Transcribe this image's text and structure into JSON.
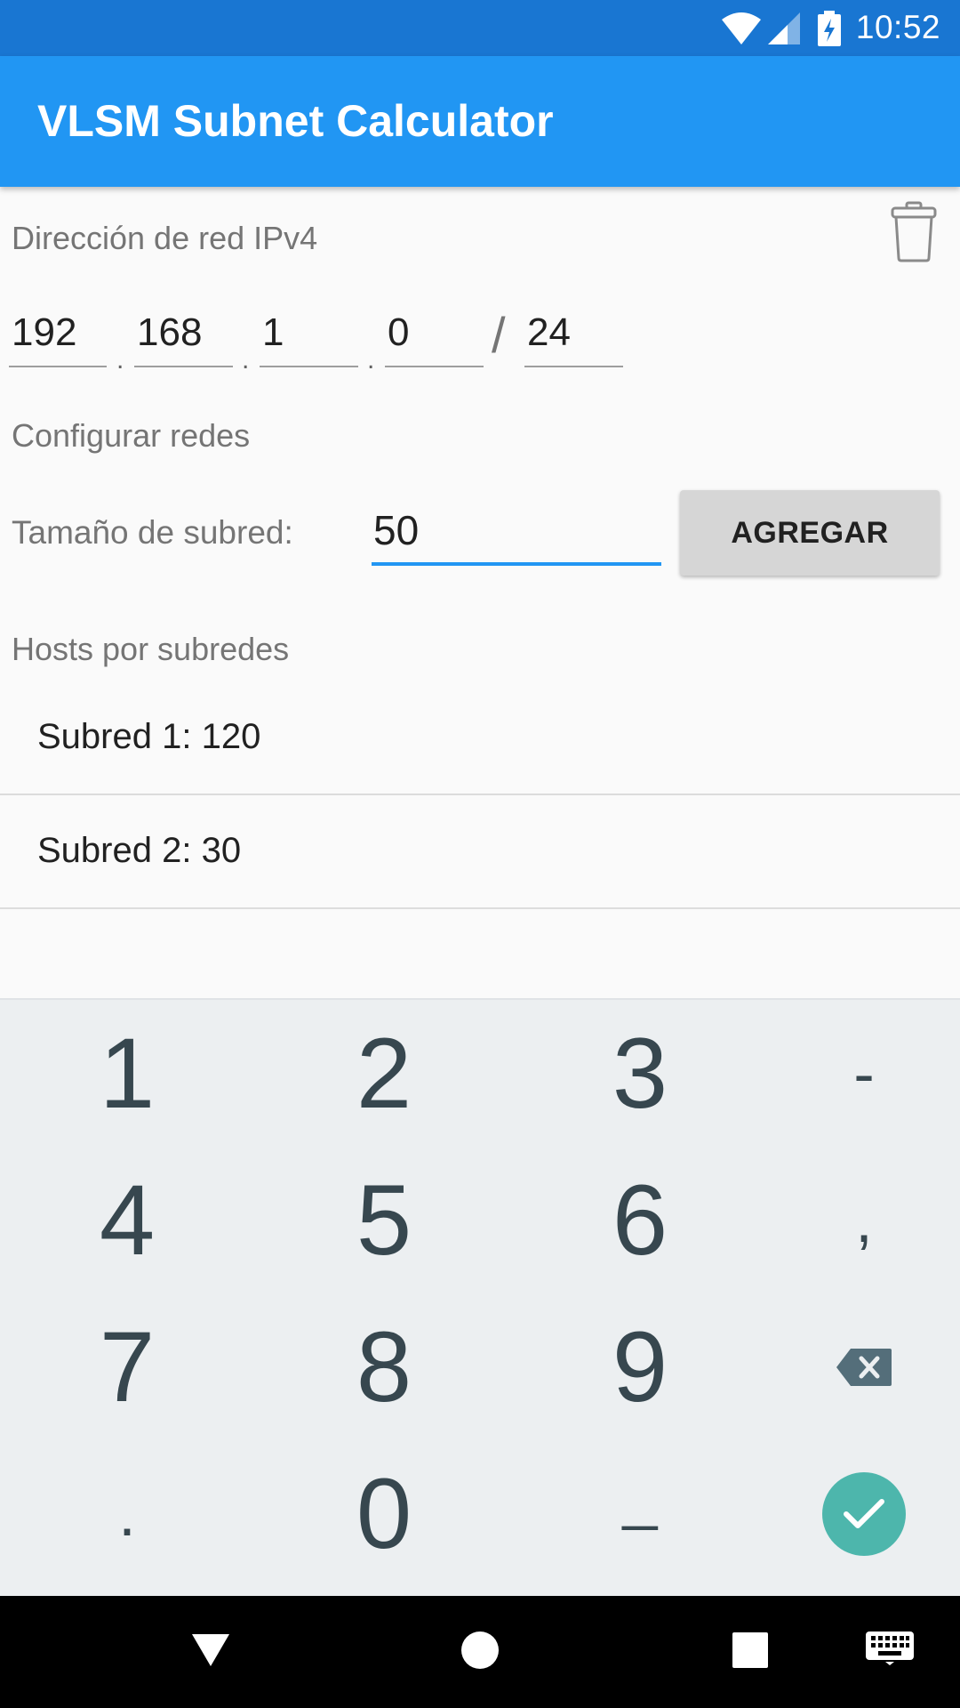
{
  "status_bar": {
    "time": "10:52"
  },
  "app_bar": {
    "title": "VLSM Subnet Calculator"
  },
  "network": {
    "label": "Dirección de red IPv4",
    "octets": [
      "192",
      "168",
      "1",
      "0"
    ],
    "prefix": "24"
  },
  "config": {
    "label": "Configurar redes",
    "size_label": "Tamaño de subred:",
    "size_value": "50",
    "add_button": "AGREGAR"
  },
  "hosts": {
    "label": "Hosts por subredes",
    "items": [
      {
        "text": "Subred 1:  120"
      },
      {
        "text": "Subred 2:  30"
      }
    ]
  },
  "keyboard": {
    "rows": [
      [
        "1",
        "2",
        "3",
        "-"
      ],
      [
        "4",
        "5",
        "6",
        ","
      ],
      [
        "7",
        "8",
        "9",
        "backspace-icon"
      ],
      [
        ".",
        "0",
        "_",
        "done-icon"
      ]
    ],
    "accent": "#4db6ac"
  },
  "colors": {
    "primary": "#2196f3",
    "primary_dark": "#1976d2"
  }
}
